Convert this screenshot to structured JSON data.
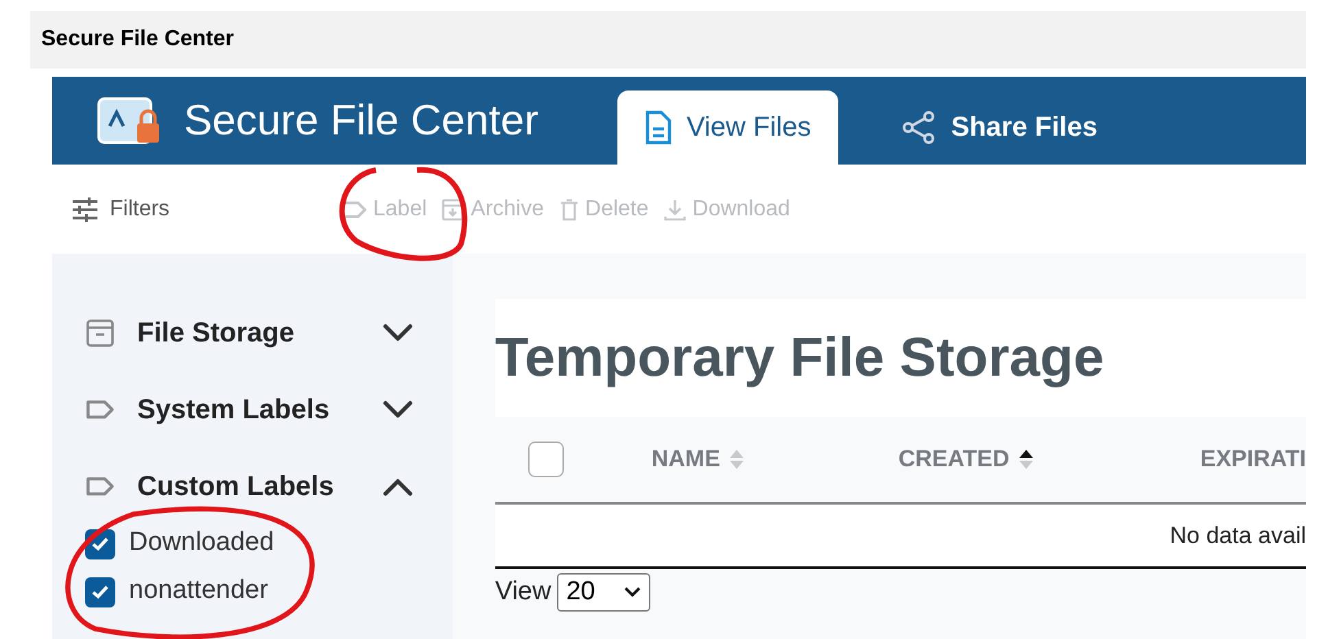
{
  "window": {
    "title": "Secure File Center"
  },
  "header": {
    "app_name": "Secure File Center",
    "tabs": [
      {
        "label": "View Files",
        "selected": true,
        "kind": "file"
      },
      {
        "label": "Share Files",
        "selected": false,
        "kind": "share"
      }
    ]
  },
  "toolbar": {
    "filters": "Filters",
    "actions": [
      {
        "label": "Label",
        "kind": "label",
        "disabled": true
      },
      {
        "label": "Archive",
        "kind": "archive",
        "disabled": true
      },
      {
        "label": "Delete",
        "kind": "delete",
        "disabled": true
      },
      {
        "label": "Download",
        "kind": "download",
        "disabled": true
      }
    ]
  },
  "sidebar": {
    "sections": [
      {
        "label": "File Storage",
        "kind": "storage",
        "expanded": false
      },
      {
        "label": "System Labels",
        "kind": "label",
        "expanded": false
      },
      {
        "label": "Custom Labels",
        "kind": "label",
        "expanded": true,
        "children": [
          {
            "label": "Downloaded",
            "checked": true
          },
          {
            "label": "nonattender",
            "checked": true
          }
        ]
      }
    ]
  },
  "main": {
    "title": "Temporary File Storage",
    "table": {
      "select_all_checked": false,
      "columns": [
        {
          "label": "NAME",
          "sorted_ascending": false
        },
        {
          "label": "CREATED",
          "sorted_ascending": true
        },
        {
          "label": "EXPIRATI"
        }
      ],
      "empty_message": "No data avail"
    },
    "pager": {
      "label": "View",
      "value": "20"
    }
  }
}
